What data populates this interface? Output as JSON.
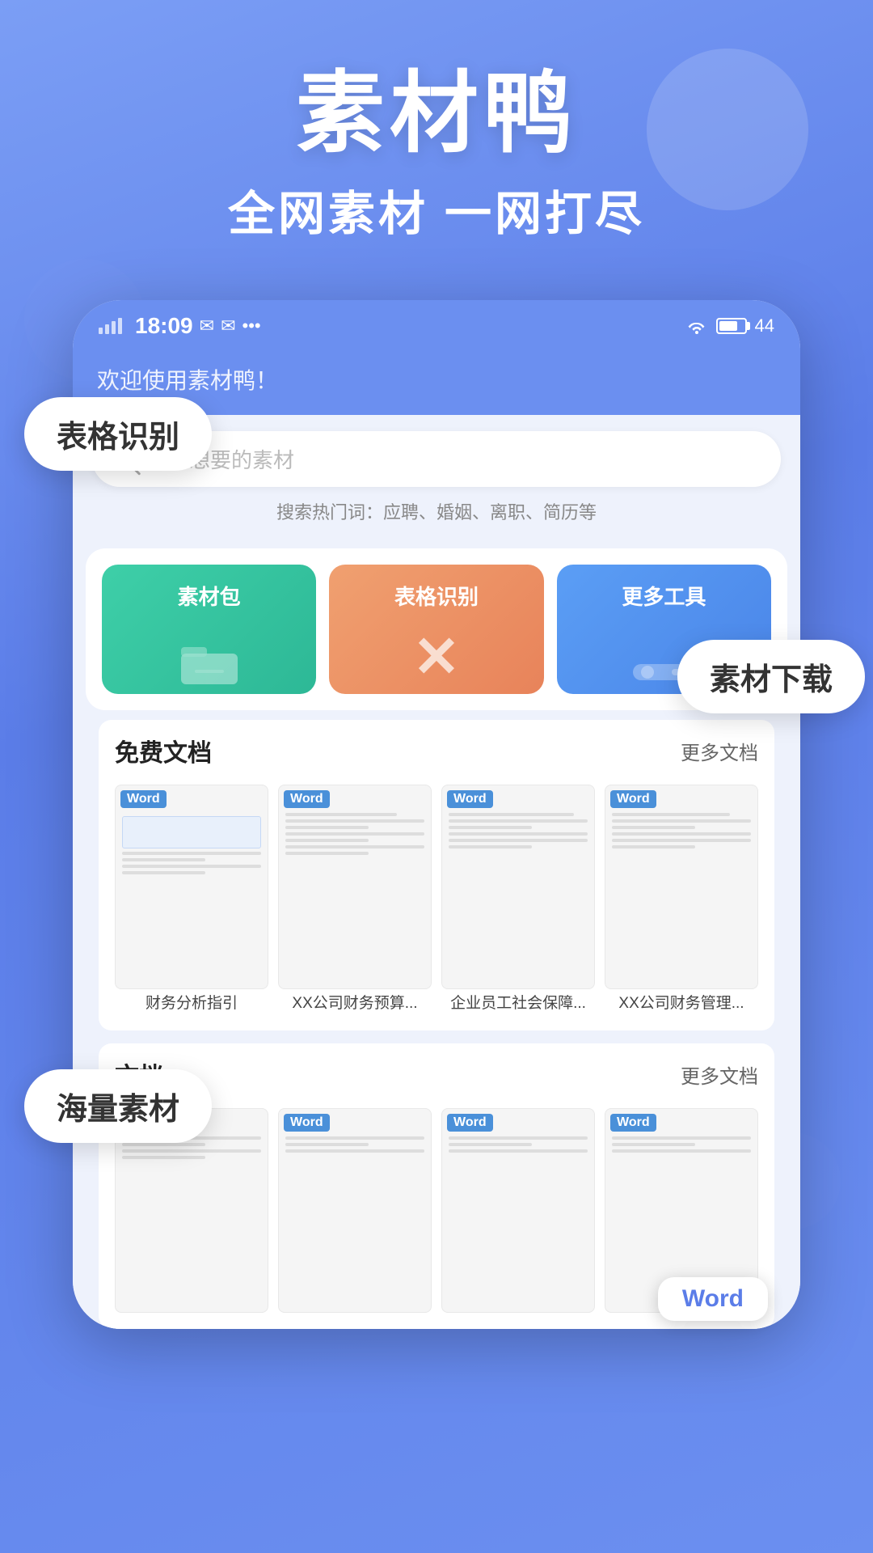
{
  "hero": {
    "title": "素材鸭",
    "subtitle": "全网素材   一网打尽"
  },
  "float_labels": {
    "table_recognize": "表格识别",
    "material_download": "素材下载",
    "mass_material": "海量素材"
  },
  "status_bar": {
    "time": "18:09",
    "battery": "44"
  },
  "app": {
    "welcome": "欢迎使用素材鸭！",
    "search_placeholder": "搜索想要的素材",
    "hot_search": "搜索热门词：应聘、婚姻、离职、简历等",
    "tool_cards": [
      {
        "label": "素材包",
        "type": "green"
      },
      {
        "label": "表格识别",
        "type": "orange"
      },
      {
        "label": "更多工具",
        "type": "blue"
      }
    ],
    "free_docs": {
      "title": "免费文档",
      "more": "更多文档",
      "items": [
        {
          "name": "财务分析指引",
          "badge": "Word",
          "has_table": true
        },
        {
          "name": "XX公司财务预算...",
          "badge": "Word",
          "has_table": false
        },
        {
          "name": "企业员工社会保障...",
          "badge": "Word",
          "has_table": false
        },
        {
          "name": "XX公司财务管理...",
          "badge": "Word",
          "has_table": false
        }
      ]
    },
    "bottom_docs": {
      "title": "文档",
      "more": "更多文档",
      "items": [
        {
          "badge": "Word"
        },
        {
          "badge": "Word"
        },
        {
          "badge": "Word"
        },
        {
          "badge": "Word"
        }
      ]
    },
    "word_label": "Word"
  }
}
